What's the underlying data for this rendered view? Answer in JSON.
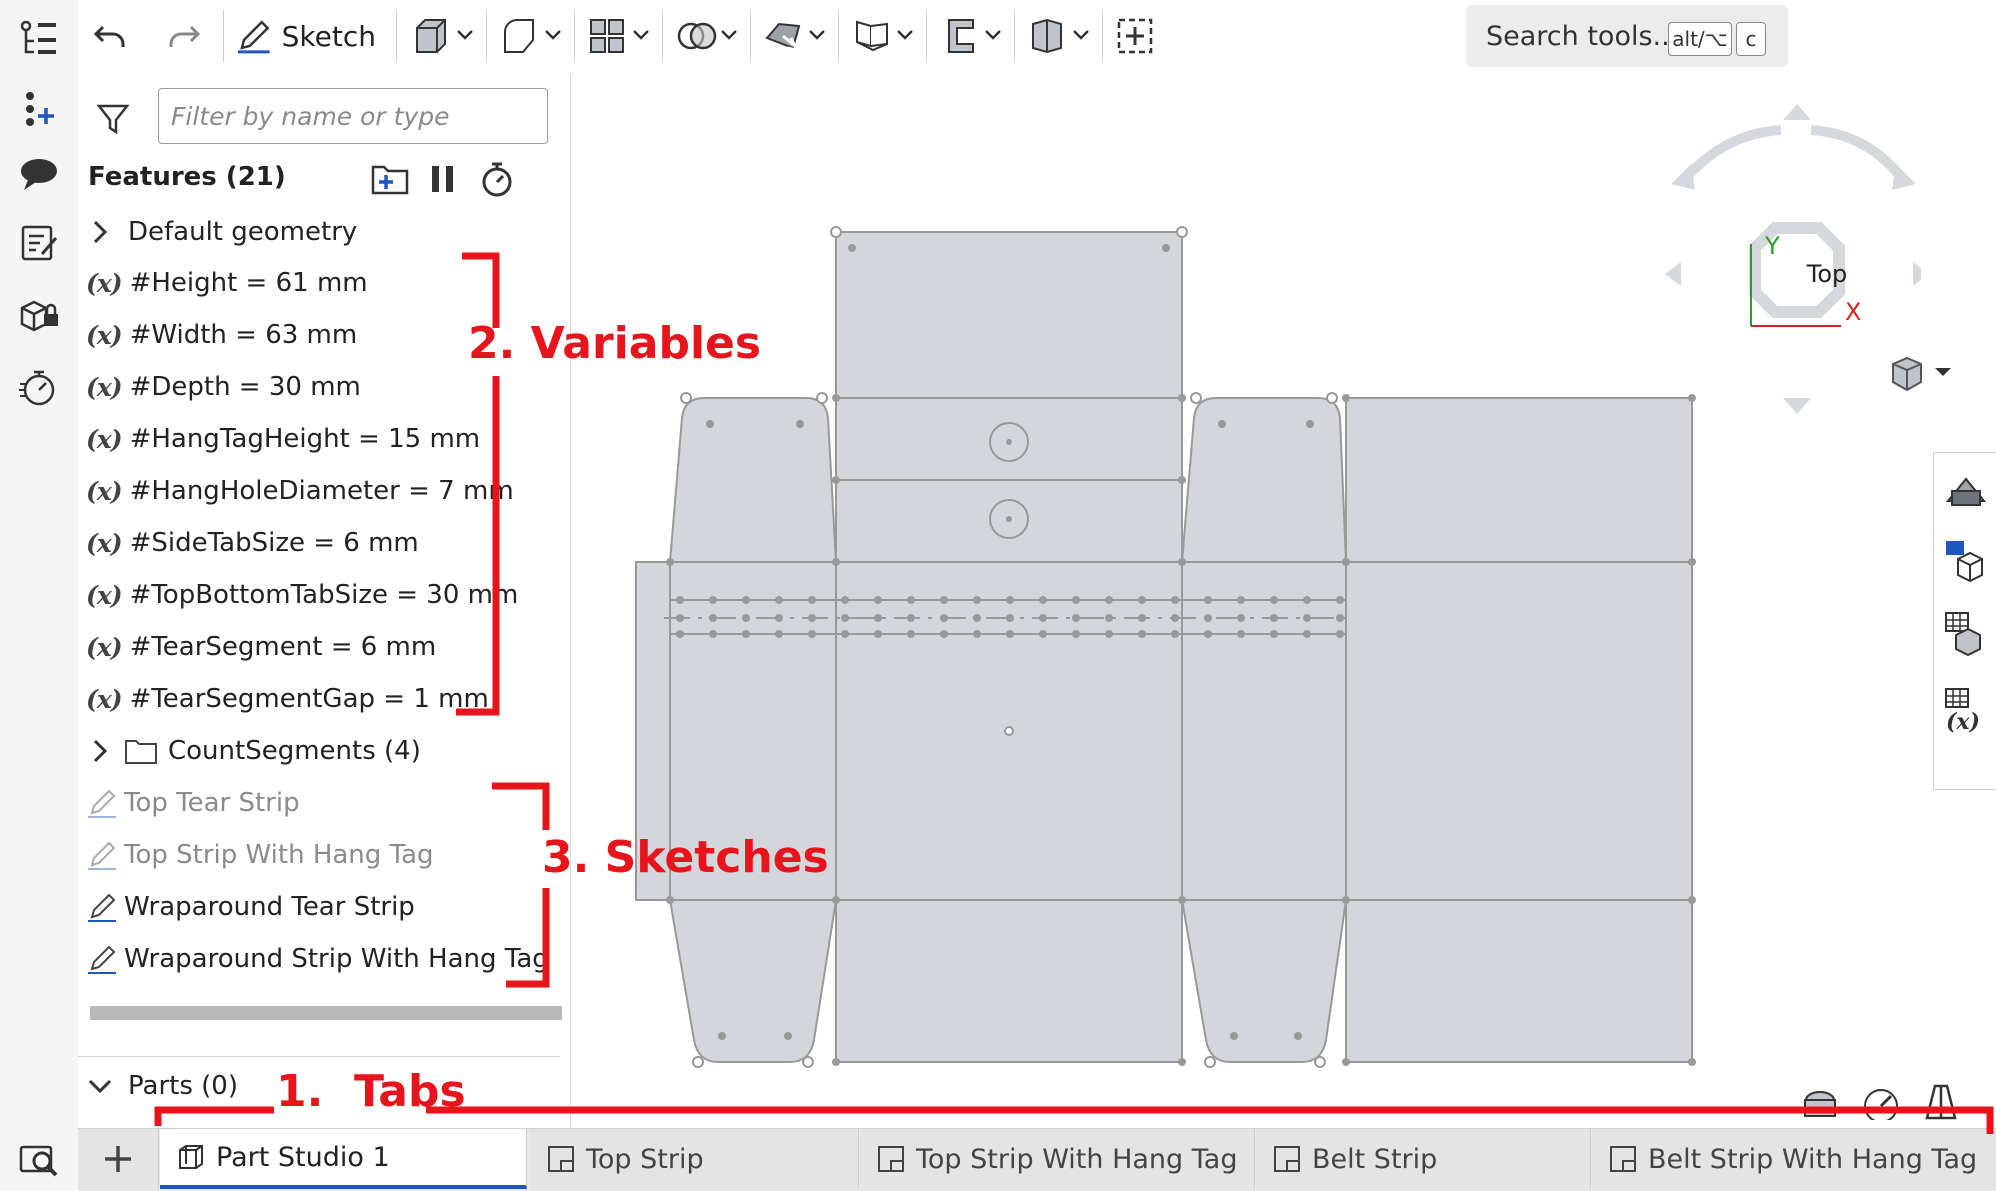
{
  "toolbar": {
    "sketch_label": "Sketch",
    "search_label": "Search tools...",
    "shortcut_alt": "alt/⌥",
    "shortcut_key": "c"
  },
  "panel": {
    "filter_placeholder": "Filter by name or type",
    "features_title": "Features (21)",
    "default_geometry": "Default geometry",
    "variables": [
      "#Height = 61 mm",
      "#Width = 63 mm",
      "#Depth = 30 mm",
      "#HangTagHeight = 15 mm",
      "#HangHoleDiameter = 7 mm",
      "#SideTabSize = 6 mm",
      "#TopBottomTabSize = 30 mm",
      "#TearSegment = 6 mm",
      "#TearSegmentGap = 1 mm"
    ],
    "folder": "CountSegments (4)",
    "sketches": [
      {
        "label": "Top Tear Strip",
        "suppressed": true
      },
      {
        "label": "Top Strip With Hang Tag",
        "suppressed": true
      },
      {
        "label": "Wraparound Tear Strip",
        "suppressed": false
      },
      {
        "label": "Wraparound Strip With Hang Tag",
        "suppressed": false
      }
    ],
    "parts": "Parts (0)",
    "variable_glyph": "(x)"
  },
  "viewcube": {
    "face": "Top",
    "axis_x": "X",
    "axis_y": "Y"
  },
  "tabs": [
    {
      "label": "Part Studio 1",
      "active": true
    },
    {
      "label": "Top Strip",
      "active": false
    },
    {
      "label": "Top Strip With Hang Tag",
      "active": false
    },
    {
      "label": "Belt Strip",
      "active": false
    },
    {
      "label": "Belt Strip With Hang Tag",
      "active": false
    }
  ],
  "annotations": {
    "tabs": "1.  Tabs",
    "variables": "2. Variables",
    "sketches": "3. Sketches"
  },
  "colors": {
    "annotation": "#e8141c",
    "accent": "#1f55c0",
    "sketch_face": "#d3d6db",
    "axis_x": "#d92020",
    "axis_y": "#22a022"
  }
}
